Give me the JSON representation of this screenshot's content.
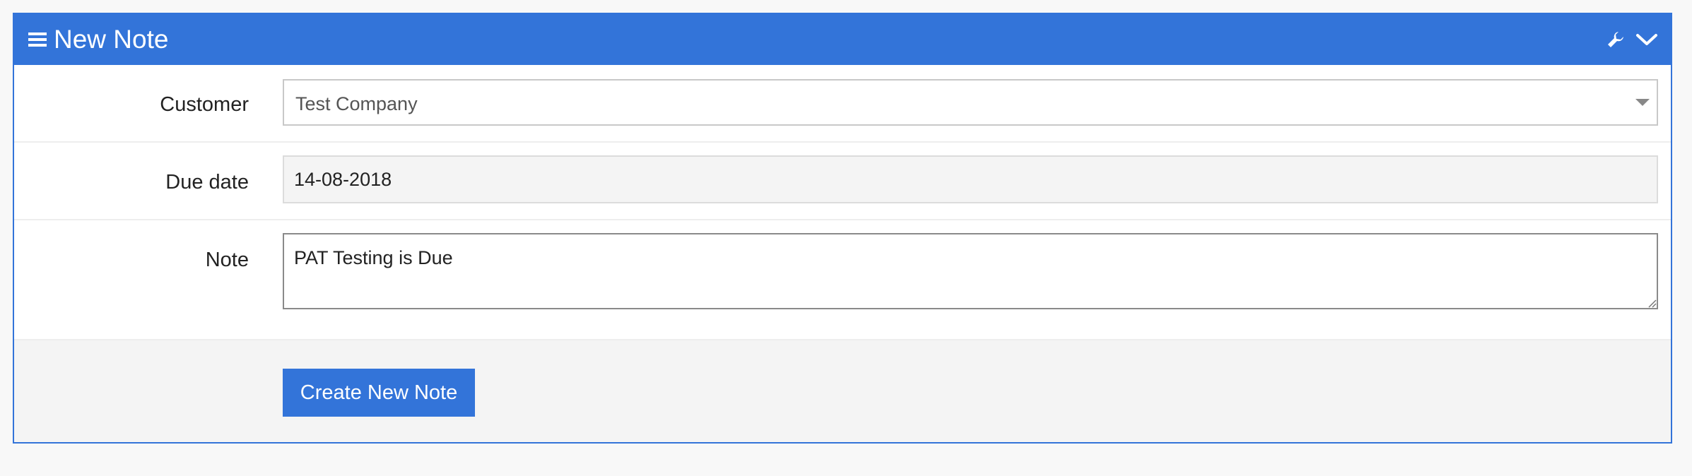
{
  "panel": {
    "title": "New Note",
    "header_icons": [
      "menu-icon",
      "wrench-icon",
      "chevron-down-icon"
    ],
    "accent_color": "#3374d9"
  },
  "form": {
    "customer": {
      "label": "Customer",
      "value": "Test Company"
    },
    "due_date": {
      "label": "Due date",
      "value": "14-08-2018"
    },
    "note": {
      "label": "Note",
      "value": "PAT Testing is Due "
    }
  },
  "footer": {
    "submit_label": "Create New Note"
  }
}
